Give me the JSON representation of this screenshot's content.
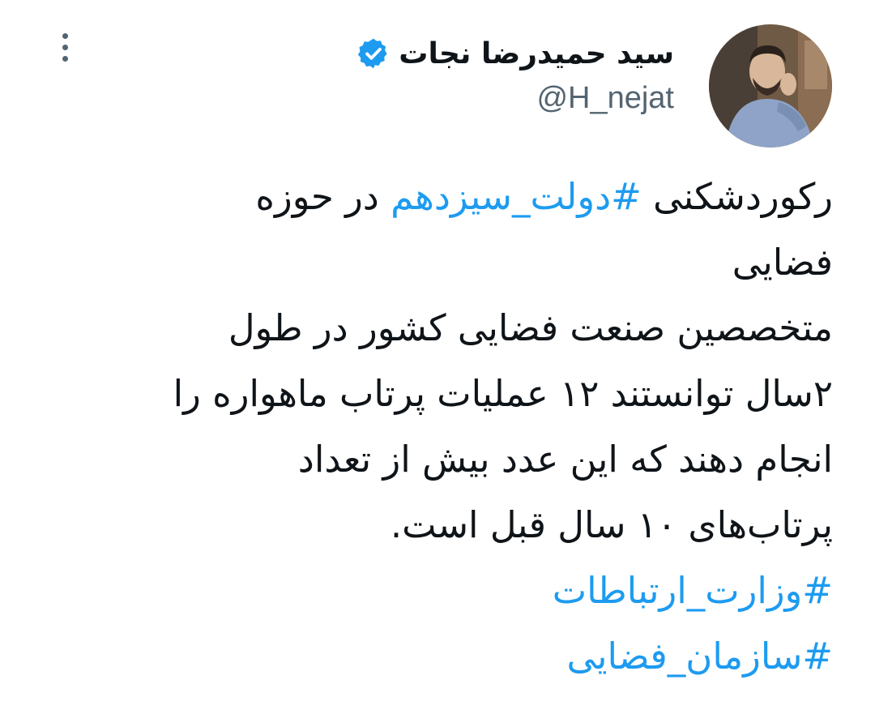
{
  "author": {
    "display_name": "سید حمیدرضا نجات",
    "handle": "@H_nejat",
    "verified": true
  },
  "icons": {
    "verified": "verified-badge-icon",
    "more": "more-options-icon"
  },
  "colors": {
    "text": "#0f1419",
    "secondary": "#536471",
    "link": "#1d9bf0",
    "verified": "#1d9bf0"
  },
  "tweet": {
    "line1_before": "رکوردشکنی ",
    "line1_hashtag": "#دولت_سیزدهم",
    "line1_after": " در حوزه",
    "line2": "فضایی",
    "line3": "متخصصین صنعت فضایی کشور در طول",
    "line4": "۲سال  توانستند ۱۲ عملیات پرتاب ماهواره را",
    "line5": "انجام دهند که این عدد بیش از تعداد",
    "line6": "پرتاب‌های ۱۰ سال قبل است.",
    "hashtag_ministry": "#وزارت_ارتباطات",
    "hashtag_space_agency": "#سازمان_فضایی"
  }
}
